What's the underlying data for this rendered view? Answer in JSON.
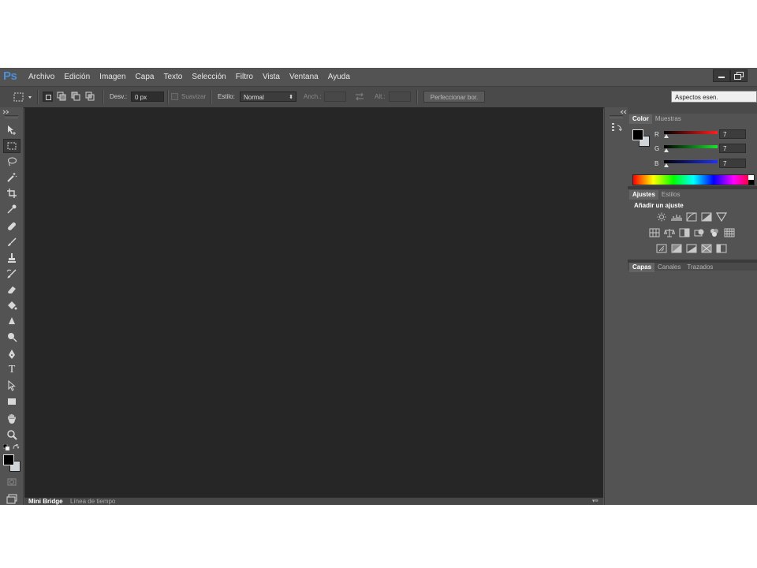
{
  "app": {
    "logo": "Ps"
  },
  "menu": [
    "Archivo",
    "Edición",
    "Imagen",
    "Capa",
    "Texto",
    "Selección",
    "Filtro",
    "Vista",
    "Ventana",
    "Ayuda"
  ],
  "options": {
    "feather_label": "Desv.:",
    "feather_value": "0 px",
    "antialias_label": "Suavizar",
    "style_label": "Estilo:",
    "style_value": "Normal",
    "width_label": "Anch.:",
    "height_label": "Alt.:",
    "refine_button": "Perfeccionar bor.",
    "workspace": "Aspectos esen."
  },
  "color_panel": {
    "tabs": [
      "Color",
      "Muestras"
    ],
    "channels": [
      {
        "label": "R",
        "value": "7",
        "color": "#e03030"
      },
      {
        "label": "G",
        "value": "7",
        "color": "#20c030"
      },
      {
        "label": "B",
        "value": "7",
        "color": "#2040e0"
      }
    ]
  },
  "adjustments_panel": {
    "tabs": [
      "Ajustes",
      "Estilos"
    ],
    "heading": "Añadir un ajuste"
  },
  "layers_panel": {
    "tabs": [
      "Capas",
      "Canales",
      "Trazados"
    ]
  },
  "bottom_tabs": [
    "Mini Bridge",
    "Línea de tiempo"
  ],
  "colors": {
    "background": "#535353",
    "canvas": "#262626",
    "accent": "#4a90d9"
  }
}
